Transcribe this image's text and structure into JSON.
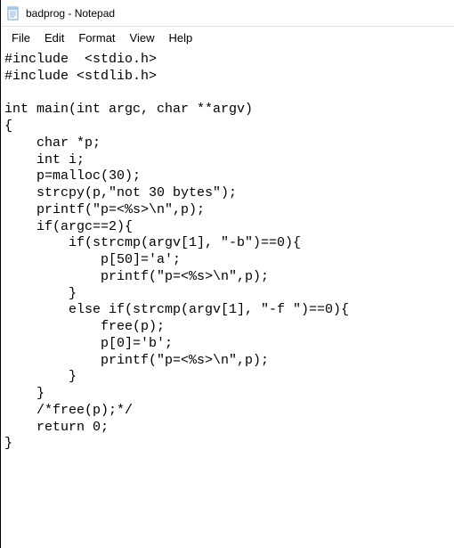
{
  "window": {
    "title": "badprog - Notepad"
  },
  "menu": {
    "file": "File",
    "edit": "Edit",
    "format": "Format",
    "view": "View",
    "help": "Help"
  },
  "editor": {
    "content": "#include  <stdio.h>\n#include <stdlib.h>\n\nint main(int argc, char **argv)\n{\n    char *p;\n    int i;\n    p=malloc(30);\n    strcpy(p,\"not 30 bytes\");\n    printf(\"p=<%s>\\n\",p);\n    if(argc==2){\n        if(strcmp(argv[1], \"-b\")==0){\n            p[50]='a';\n            printf(\"p=<%s>\\n\",p);\n        }\n        else if(strcmp(argv[1], \"-f \")==0){\n            free(p);\n            p[0]='b';\n            printf(\"p=<%s>\\n\",p);\n        }\n    }\n    /*free(p);*/\n    return 0;\n}"
  }
}
